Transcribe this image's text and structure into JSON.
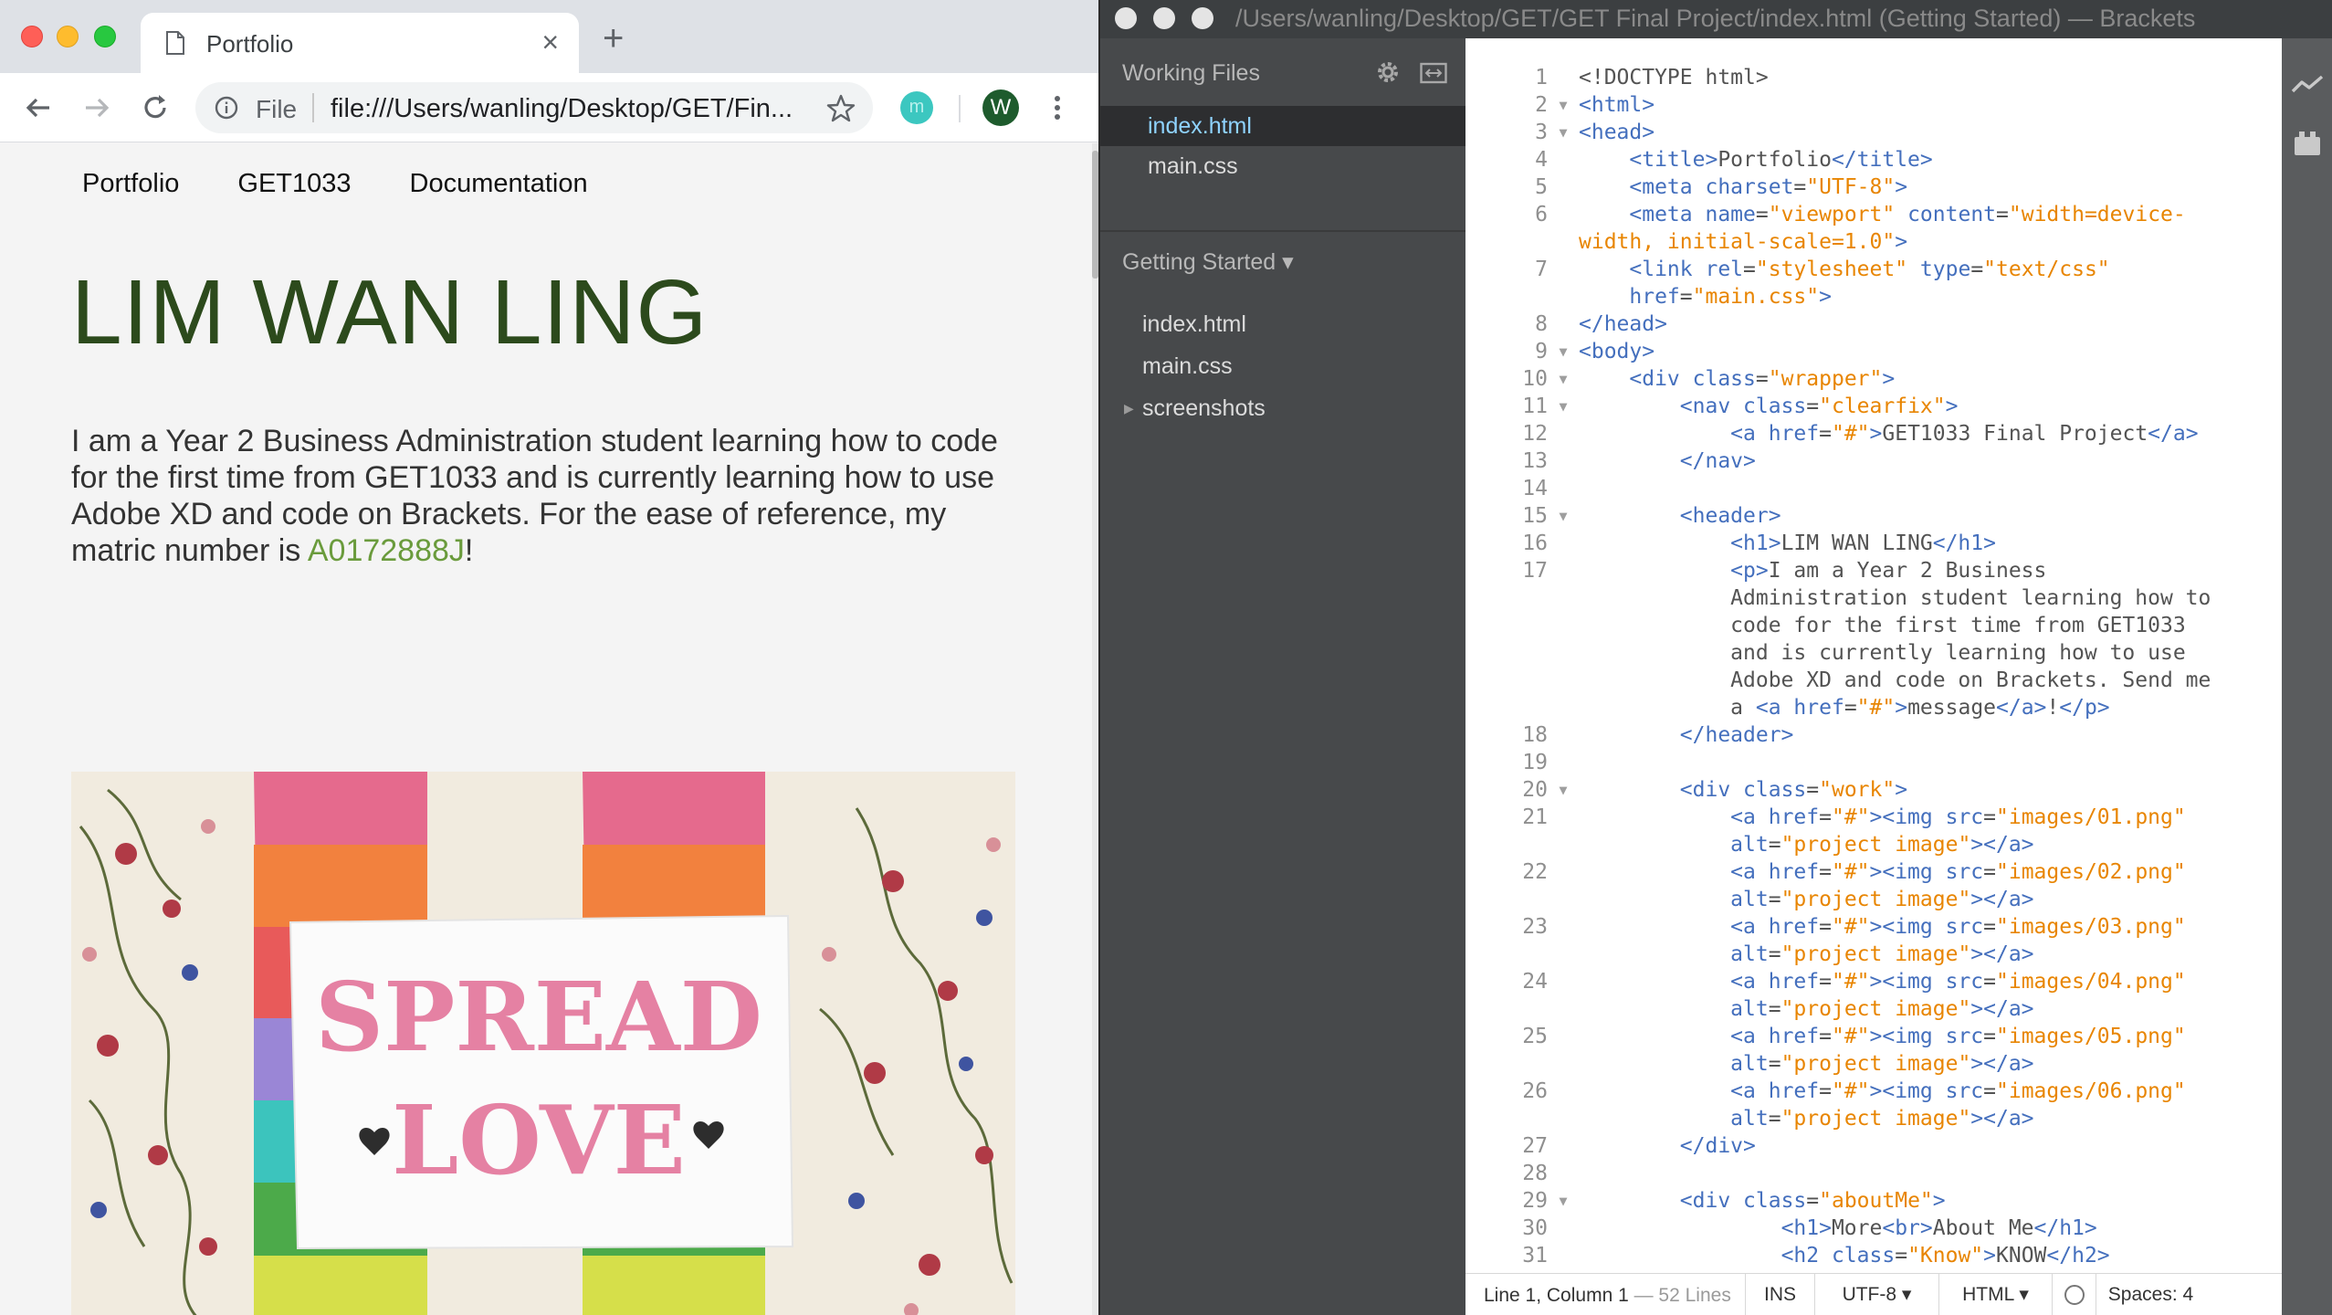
{
  "chrome": {
    "tab_title": "Portfolio",
    "tab_close": "×",
    "new_tab": "+",
    "scheme_label": "File",
    "url": "file:///Users/wanling/Desktop/GET/Fin...",
    "profile_initial": "W",
    "extension_initial": "m"
  },
  "site": {
    "nav": [
      "Portfolio",
      "GET1033",
      "Documentation"
    ],
    "title": "LIM WAN LING",
    "intro_before": "I am a Year 2 Business Administration student learning how to code for the first time from GET1033 and is currently learning how to use Adobe XD and code on Brackets. For the ease of reference, my matric number is ",
    "matric": "A0172888J",
    "intro_after": "!",
    "photo_card_line1": "SPREAD",
    "photo_card_line2": "LOVE"
  },
  "brackets": {
    "title": "/Users/wanling/Desktop/GET/GET Final Project/index.html (Getting Started) — Brackets",
    "working_files_header": "Working Files",
    "working_files": [
      "index.html",
      "main.css"
    ],
    "project_header": "Getting Started ▾",
    "project_files": [
      "index.html",
      "main.css",
      "screenshots"
    ],
    "status": {
      "cursor": "Line 1, Column 1",
      "lines": " — 52 Lines",
      "mode": "INS",
      "encoding": "UTF-8 ▾",
      "language": "HTML ▾",
      "spaces": "Spaces: 4"
    },
    "code": [
      {
        "n": "1",
        "f": "",
        "s": [
          [
            "x",
            "<!DOCTYPE html>"
          ]
        ]
      },
      {
        "n": "2",
        "f": "▼",
        "s": [
          [
            "t",
            "<html>"
          ]
        ]
      },
      {
        "n": "3",
        "f": "▼",
        "s": [
          [
            "t",
            "<head>"
          ]
        ]
      },
      {
        "n": "4",
        "f": "",
        "s": [
          [
            "x",
            "    "
          ],
          [
            "t",
            "<title>"
          ],
          [
            "x",
            "Portfolio"
          ],
          [
            "t",
            "</title>"
          ]
        ]
      },
      {
        "n": "5",
        "f": "",
        "s": [
          [
            "x",
            "    "
          ],
          [
            "t",
            "<meta "
          ],
          [
            "a",
            "charset"
          ],
          [
            "x",
            "="
          ],
          [
            "v",
            "\"UTF-8\""
          ],
          [
            "t",
            ">"
          ]
        ]
      },
      {
        "n": "6",
        "f": "",
        "s": [
          [
            "x",
            "    "
          ],
          [
            "t",
            "<meta "
          ],
          [
            "a",
            "name"
          ],
          [
            "x",
            "="
          ],
          [
            "v",
            "\"viewport\""
          ],
          [
            "x",
            " "
          ],
          [
            "a",
            "content"
          ],
          [
            "x",
            "="
          ],
          [
            "v",
            "\"width=device-\nwidth, initial-scale=1.0\""
          ],
          [
            "t",
            ">"
          ]
        ]
      },
      {
        "n": "7",
        "f": "",
        "s": [
          [
            "x",
            "    "
          ],
          [
            "t",
            "<link "
          ],
          [
            "a",
            "rel"
          ],
          [
            "x",
            "="
          ],
          [
            "v",
            "\"stylesheet\""
          ],
          [
            "x",
            " "
          ],
          [
            "a",
            "type"
          ],
          [
            "x",
            "="
          ],
          [
            "v",
            "\"text/css\""
          ],
          [
            "x",
            "\n    "
          ],
          [
            "a",
            "href"
          ],
          [
            "x",
            "="
          ],
          [
            "v",
            "\"main.css\""
          ],
          [
            "t",
            ">"
          ]
        ]
      },
      {
        "n": "8",
        "f": "",
        "s": [
          [
            "t",
            "</head>"
          ]
        ]
      },
      {
        "n": "9",
        "f": "▼",
        "s": [
          [
            "t",
            "<body>"
          ]
        ]
      },
      {
        "n": "10",
        "f": "▼",
        "s": [
          [
            "x",
            "    "
          ],
          [
            "t",
            "<div "
          ],
          [
            "a",
            "class"
          ],
          [
            "x",
            "="
          ],
          [
            "v",
            "\"wrapper\""
          ],
          [
            "t",
            ">"
          ]
        ]
      },
      {
        "n": "11",
        "f": "▼",
        "s": [
          [
            "x",
            "        "
          ],
          [
            "t",
            "<nav "
          ],
          [
            "a",
            "class"
          ],
          [
            "x",
            "="
          ],
          [
            "v",
            "\"clearfix\""
          ],
          [
            "t",
            ">"
          ]
        ]
      },
      {
        "n": "12",
        "f": "",
        "s": [
          [
            "x",
            "            "
          ],
          [
            "t",
            "<a "
          ],
          [
            "a",
            "href"
          ],
          [
            "x",
            "="
          ],
          [
            "v",
            "\"#\""
          ],
          [
            "t",
            ">"
          ],
          [
            "x",
            "GET1033 Final Project"
          ],
          [
            "t",
            "</a>"
          ]
        ]
      },
      {
        "n": "13",
        "f": "",
        "s": [
          [
            "x",
            "        "
          ],
          [
            "t",
            "</nav>"
          ]
        ]
      },
      {
        "n": "14",
        "f": "",
        "s": [
          [
            "x",
            ""
          ]
        ]
      },
      {
        "n": "15",
        "f": "▼",
        "s": [
          [
            "x",
            "        "
          ],
          [
            "t",
            "<header>"
          ]
        ]
      },
      {
        "n": "16",
        "f": "",
        "s": [
          [
            "x",
            "            "
          ],
          [
            "t",
            "<h1>"
          ],
          [
            "x",
            "LIM WAN LING"
          ],
          [
            "t",
            "</h1>"
          ]
        ]
      },
      {
        "n": "17",
        "f": "",
        "s": [
          [
            "x",
            "            "
          ],
          [
            "t",
            "<p>"
          ],
          [
            "x",
            "I am a Year 2 Business\n            Administration student learning how to\n            code for the first time from GET1033\n            and is currently learning how to use\n            Adobe XD and code on Brackets. Send me\n            a "
          ],
          [
            "t",
            "<a "
          ],
          [
            "a",
            "href"
          ],
          [
            "x",
            "="
          ],
          [
            "v",
            "\"#\""
          ],
          [
            "t",
            ">"
          ],
          [
            "x",
            "message"
          ],
          [
            "t",
            "</a>"
          ],
          [
            "x",
            "!"
          ],
          [
            "t",
            "</p>"
          ]
        ]
      },
      {
        "n": "18",
        "f": "",
        "s": [
          [
            "x",
            "        "
          ],
          [
            "t",
            "</header>"
          ]
        ]
      },
      {
        "n": "19",
        "f": "",
        "s": [
          [
            "x",
            ""
          ]
        ]
      },
      {
        "n": "20",
        "f": "▼",
        "s": [
          [
            "x",
            "        "
          ],
          [
            "t",
            "<div "
          ],
          [
            "a",
            "class"
          ],
          [
            "x",
            "="
          ],
          [
            "v",
            "\"work\""
          ],
          [
            "t",
            ">"
          ]
        ]
      },
      {
        "n": "21",
        "f": "",
        "s": [
          [
            "x",
            "            "
          ],
          [
            "t",
            "<a "
          ],
          [
            "a",
            "href"
          ],
          [
            "x",
            "="
          ],
          [
            "v",
            "\"#\""
          ],
          [
            "t",
            "><img "
          ],
          [
            "a",
            "src"
          ],
          [
            "x",
            "="
          ],
          [
            "v",
            "\"images/01.png\""
          ],
          [
            "x",
            "\n            "
          ],
          [
            "a",
            "alt"
          ],
          [
            "x",
            "="
          ],
          [
            "v",
            "\"project image\""
          ],
          [
            "t",
            "></a>"
          ]
        ]
      },
      {
        "n": "22",
        "f": "",
        "s": [
          [
            "x",
            "            "
          ],
          [
            "t",
            "<a "
          ],
          [
            "a",
            "href"
          ],
          [
            "x",
            "="
          ],
          [
            "v",
            "\"#\""
          ],
          [
            "t",
            "><img "
          ],
          [
            "a",
            "src"
          ],
          [
            "x",
            "="
          ],
          [
            "v",
            "\"images/02.png\""
          ],
          [
            "x",
            "\n            "
          ],
          [
            "a",
            "alt"
          ],
          [
            "x",
            "="
          ],
          [
            "v",
            "\"project image\""
          ],
          [
            "t",
            "></a>"
          ]
        ]
      },
      {
        "n": "23",
        "f": "",
        "s": [
          [
            "x",
            "            "
          ],
          [
            "t",
            "<a "
          ],
          [
            "a",
            "href"
          ],
          [
            "x",
            "="
          ],
          [
            "v",
            "\"#\""
          ],
          [
            "t",
            "><img "
          ],
          [
            "a",
            "src"
          ],
          [
            "x",
            "="
          ],
          [
            "v",
            "\"images/03.png\""
          ],
          [
            "x",
            "\n            "
          ],
          [
            "a",
            "alt"
          ],
          [
            "x",
            "="
          ],
          [
            "v",
            "\"project image\""
          ],
          [
            "t",
            "></a>"
          ]
        ]
      },
      {
        "n": "24",
        "f": "",
        "s": [
          [
            "x",
            "            "
          ],
          [
            "t",
            "<a "
          ],
          [
            "a",
            "href"
          ],
          [
            "x",
            "="
          ],
          [
            "v",
            "\"#\""
          ],
          [
            "t",
            "><img "
          ],
          [
            "a",
            "src"
          ],
          [
            "x",
            "="
          ],
          [
            "v",
            "\"images/04.png\""
          ],
          [
            "x",
            "\n            "
          ],
          [
            "a",
            "alt"
          ],
          [
            "x",
            "="
          ],
          [
            "v",
            "\"project image\""
          ],
          [
            "t",
            "></a>"
          ]
        ]
      },
      {
        "n": "25",
        "f": "",
        "s": [
          [
            "x",
            "            "
          ],
          [
            "t",
            "<a "
          ],
          [
            "a",
            "href"
          ],
          [
            "x",
            "="
          ],
          [
            "v",
            "\"#\""
          ],
          [
            "t",
            "><img "
          ],
          [
            "a",
            "src"
          ],
          [
            "x",
            "="
          ],
          [
            "v",
            "\"images/05.png\""
          ],
          [
            "x",
            "\n            "
          ],
          [
            "a",
            "alt"
          ],
          [
            "x",
            "="
          ],
          [
            "v",
            "\"project image\""
          ],
          [
            "t",
            "></a>"
          ]
        ]
      },
      {
        "n": "26",
        "f": "",
        "s": [
          [
            "x",
            "            "
          ],
          [
            "t",
            "<a "
          ],
          [
            "a",
            "href"
          ],
          [
            "x",
            "="
          ],
          [
            "v",
            "\"#\""
          ],
          [
            "t",
            "><img "
          ],
          [
            "a",
            "src"
          ],
          [
            "x",
            "="
          ],
          [
            "v",
            "\"images/06.png\""
          ],
          [
            "x",
            "\n            "
          ],
          [
            "a",
            "alt"
          ],
          [
            "x",
            "="
          ],
          [
            "v",
            "\"project image\""
          ],
          [
            "t",
            "></a>"
          ]
        ]
      },
      {
        "n": "27",
        "f": "",
        "s": [
          [
            "x",
            "        "
          ],
          [
            "t",
            "</div>"
          ]
        ]
      },
      {
        "n": "28",
        "f": "",
        "s": [
          [
            "x",
            ""
          ]
        ]
      },
      {
        "n": "29",
        "f": "▼",
        "s": [
          [
            "x",
            "        "
          ],
          [
            "t",
            "<div "
          ],
          [
            "a",
            "class"
          ],
          [
            "x",
            "="
          ],
          [
            "v",
            "\"aboutMe\""
          ],
          [
            "t",
            ">"
          ]
        ]
      },
      {
        "n": "30",
        "f": "",
        "s": [
          [
            "x",
            "                "
          ],
          [
            "t",
            "<h1>"
          ],
          [
            "x",
            "More"
          ],
          [
            "t",
            "<br>"
          ],
          [
            "x",
            "About Me"
          ],
          [
            "t",
            "</h1>"
          ]
        ]
      },
      {
        "n": "31",
        "f": "",
        "s": [
          [
            "x",
            "                "
          ],
          [
            "t",
            "<h2 "
          ],
          [
            "a",
            "class"
          ],
          [
            "x",
            "="
          ],
          [
            "v",
            "\"Know\""
          ],
          [
            "t",
            ">"
          ],
          [
            "x",
            "KNOW"
          ],
          [
            "t",
            "</h2>"
          ]
        ]
      }
    ]
  }
}
